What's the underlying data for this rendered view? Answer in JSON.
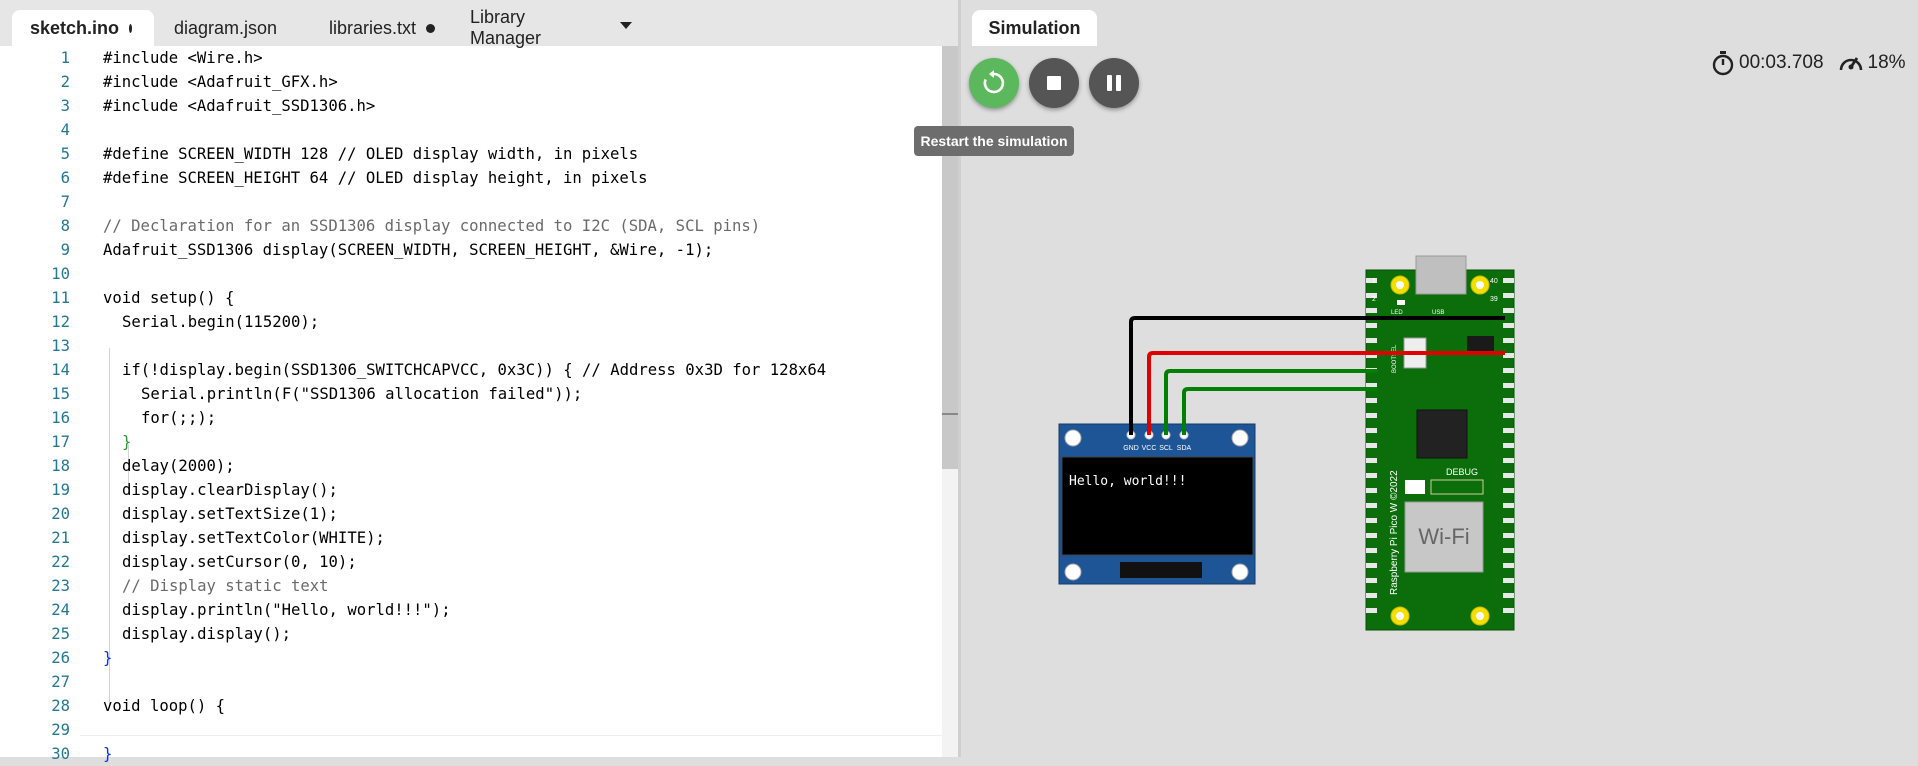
{
  "editor": {
    "tabs": [
      {
        "label": "sketch.ino"
      },
      {
        "label": "diagram.json"
      },
      {
        "label": "libraries.txt"
      },
      {
        "label": "Library Manager"
      }
    ]
  },
  "code_lines": [
    "1",
    "2",
    "3",
    "4",
    "5",
    "6",
    "7",
    "8",
    "9",
    "10",
    "11",
    "12",
    "13",
    "14",
    "15",
    "16",
    "17",
    "18",
    "19",
    "20",
    "21",
    "22",
    "23",
    "24",
    "25",
    "26",
    "27",
    "28",
    "29",
    "30"
  ],
  "code": {
    "l1": "#include <Wire.h>",
    "l2": "#include <Adafruit_GFX.h>",
    "l3": "#include <Adafruit_SSD1306.h>",
    "l5": "#define SCREEN_WIDTH 128 // OLED display width, in pixels",
    "l6": "#define SCREEN_HEIGHT 64 // OLED display height, in pixels",
    "l8": "// Declaration for an SSD1306 display connected to I2C (SDA, SCL pins)",
    "l9": "Adafruit_SSD1306 display(SCREEN_WIDTH, SCREEN_HEIGHT, &Wire, -1);",
    "l11": "void setup() {",
    "l12": "Serial.begin(115200);",
    "l14": "if(!display.begin(SSD1306_SWITCHCAPVCC, 0x3C)) { // Address 0x3D for 128x64",
    "l15": "Serial.println(F(\"SSD1306 allocation failed\"));",
    "l16": "for(;;);",
    "l17": "}",
    "l18": "delay(2000);",
    "l19": "display.clearDisplay();",
    "l20": "display.setTextSize(1);",
    "l21": "display.setTextColor(WHITE);",
    "l22": "display.setCursor(0, 10);",
    "l23": "// Display static text",
    "l24": "display.println(\"Hello, world!!!\");",
    "l25": "display.display();",
    "l26": "}",
    "l28": "void loop() {",
    "l30": "}"
  },
  "simulation": {
    "tab_label": "Simulation",
    "tooltip": "Restart the simulation",
    "timer": "00:03.708",
    "speed": "18%",
    "restart_color": "#5cb85c",
    "button_color": "#555555"
  },
  "oled": {
    "pins": [
      "GND",
      "VCC",
      "SCL",
      "SDA"
    ],
    "screen_text": "Hello, world!!!"
  },
  "pico": {
    "label": "Raspberry Pi Pico W ©2022",
    "debug": "DEBUG",
    "wifi": "Wi-Fi",
    "led": "LED",
    "usb": "USB",
    "bootsel": "BOOTSEL",
    "pin1": "1",
    "pin2": "2",
    "pin39": "39",
    "pin40": "40",
    "board_color": "#0b6e0b"
  },
  "wires": {
    "gnd_color": "#000000",
    "vcc_color": "#e00000",
    "i2c_color": "#008000"
  }
}
